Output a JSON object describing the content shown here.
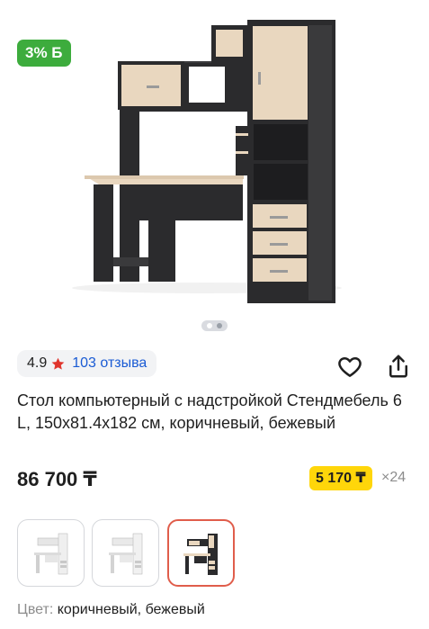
{
  "hero": {
    "bonus_badge": "3% Б",
    "image_icon": "computer-desk-product-image"
  },
  "carousel": {
    "dot_count": 2,
    "active_index": 1
  },
  "rating": {
    "value": "4.9",
    "star_icon": "star-icon",
    "reviews_text": "103 отзыва"
  },
  "actions": {
    "favorite_icon": "heart-icon",
    "share_icon": "share-icon"
  },
  "product": {
    "title": "Стол компьютерный с надстройкой Стендмебель 6 L, 150x81.4x182 см, коричневый, бежевый",
    "price": "86 700 ₸",
    "installment_price": "5 170 ₸",
    "installment_count": "×24"
  },
  "variants": [
    {
      "name": "white",
      "selected": false
    },
    {
      "name": "white-2",
      "selected": false
    },
    {
      "name": "brown-beige",
      "selected": true
    }
  ],
  "color": {
    "label": "Цвет:",
    "value": "коричневый, бежевый"
  },
  "colors": {
    "bonus_green": "#3dac3d",
    "link_blue": "#1a5bd4",
    "installment_yellow": "#ffd60a",
    "star_red": "#e0342c",
    "selected_border": "#e05d4b",
    "wenge": "#2b2b2d",
    "beige": "#e9d7bf"
  }
}
